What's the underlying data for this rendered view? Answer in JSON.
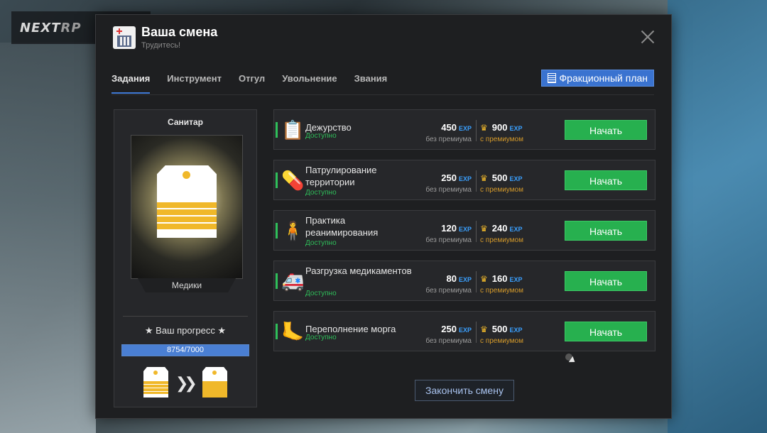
{
  "background": {
    "logo_main": "NEXT",
    "logo_rp": "RP"
  },
  "header": {
    "title": "Ваша смена",
    "subtitle": "Трудитесь!"
  },
  "tabs": [
    {
      "label": "Задания",
      "active": true
    },
    {
      "label": "Инструмент",
      "active": false
    },
    {
      "label": "Отгул",
      "active": false
    },
    {
      "label": "Увольнение",
      "active": false
    },
    {
      "label": "Звания",
      "active": false
    }
  ],
  "plan_button": {
    "label": "Фракционный план"
  },
  "rank_card": {
    "rank_name": "Санитар",
    "faction": "Медики",
    "progress_label": "★ Ваш прогресс ★",
    "progress_text": "8754/7000",
    "progress_fraction": 1.0
  },
  "tasks": [
    {
      "name": "Дежурство",
      "status": "Доступно",
      "base_exp": "450",
      "premium_exp": "900",
      "icon": "clipboard-icon"
    },
    {
      "name": "Патрулирование территории",
      "status": "Доступно",
      "base_exp": "250",
      "premium_exp": "500",
      "icon": "pills-icon"
    },
    {
      "name": "Практика реанимирования",
      "status": "Доступно",
      "base_exp": "120",
      "premium_exp": "240",
      "icon": "heartbeat-person-icon"
    },
    {
      "name": "Разгрузка медикаментов",
      "status": "Доступно",
      "base_exp": "80",
      "premium_exp": "160",
      "icon": "ambulance-icon"
    },
    {
      "name": "Переполнение морга",
      "status": "Доступно",
      "base_exp": "250",
      "premium_exp": "500",
      "icon": "toe-tag-icon"
    }
  ],
  "labels": {
    "exp_tag": "EXP",
    "without_premium": "без премиума",
    "with_premium": "с премиумом",
    "start": "Начать"
  },
  "end_button": {
    "label": "Закончить смену"
  },
  "colors": {
    "accent_blue": "#3a73d0",
    "start_green": "#27b04f",
    "available_green": "#2fbf5a",
    "premium_gold": "#f0b82a"
  }
}
